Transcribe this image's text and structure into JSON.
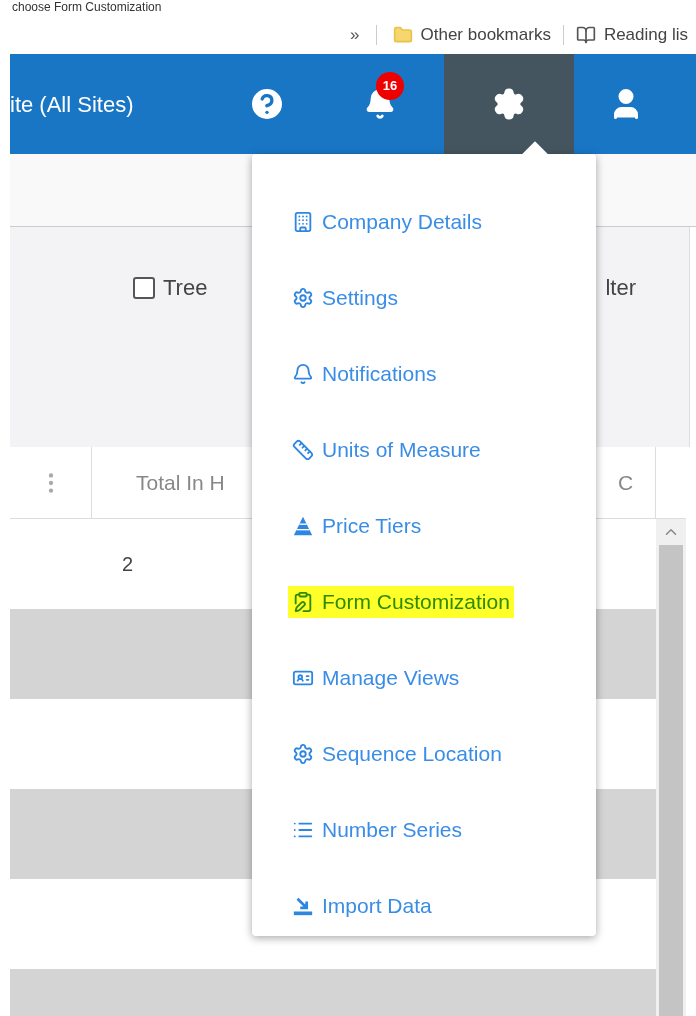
{
  "caption": "choose Form Customization",
  "bookmarks_bar": {
    "overflow": "»",
    "items": [
      {
        "label": "Other bookmarks"
      },
      {
        "label": "Reading lis"
      }
    ]
  },
  "header": {
    "site": "ite (All Sites)",
    "notifications": {
      "count": "16"
    },
    "settings": {
      "open": true
    }
  },
  "toolbar": {
    "tree": {
      "label": "Tree",
      "checked": false
    },
    "column_2": "lter"
  },
  "grid": {
    "columns": [
      "Total In H",
      "C"
    ],
    "rows": [
      [
        "2"
      ]
    ]
  },
  "settings_menu": {
    "items": [
      {
        "label": "Company Details",
        "highlighted": false
      },
      {
        "label": "Settings",
        "highlighted": false
      },
      {
        "label": "Notifications",
        "highlighted": false
      },
      {
        "label": "Units of Measure",
        "highlighted": false
      },
      {
        "label": "Price Tiers",
        "highlighted": false
      },
      {
        "label": "Form Customization",
        "highlighted": true
      },
      {
        "label": "Manage Views",
        "highlighted": false
      },
      {
        "label": "Sequence Location",
        "highlighted": false
      },
      {
        "label": "Number Series",
        "highlighted": false
      },
      {
        "label": "Import Data",
        "highlighted": false
      }
    ]
  }
}
